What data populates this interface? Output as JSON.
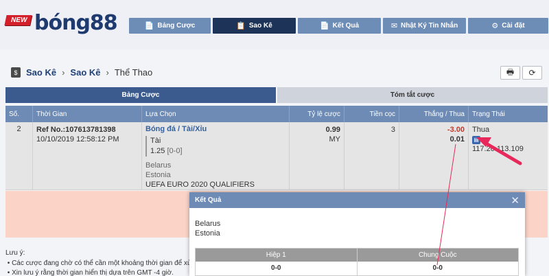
{
  "logo": {
    "badge": "NEW",
    "brand": "bóng88"
  },
  "nav": [
    {
      "icon": "📄",
      "label": "Bảng Cược"
    },
    {
      "icon": "📋",
      "label": "Sao Kê"
    },
    {
      "icon": "📄",
      "label": "Kết Quả"
    },
    {
      "icon": "✉",
      "label": "Nhật Ký Tin Nhắn"
    },
    {
      "icon": "⚙",
      "label": "Cài đặt"
    }
  ],
  "breadcrumb": {
    "icon": "$",
    "items": [
      "Sao Kê",
      "Sao Kê"
    ],
    "current": "Thể Thao",
    "sep": "›"
  },
  "tools": {
    "print": "🖶",
    "refresh": "⟳"
  },
  "tabs": [
    "Bảng Cược",
    "Tóm tắt cược"
  ],
  "table": {
    "headers": [
      "Số.",
      "Thời Gian",
      "Lựa Chọn",
      "Tỷ lệ cược",
      "Tiền cọc",
      "Thắng / Thua",
      "Trạng Thái"
    ],
    "row": {
      "no": "2",
      "ref": "Ref No.:107613781398",
      "time": "10/10/2019 12:58:12 PM",
      "sport": "Bóng đá / Tài/Xỉu",
      "pick": "Tài",
      "line": "1.25",
      "score": "[0-0]",
      "team1": "Belarus",
      "team2": "Estonia",
      "league": "UEFA EURO 2020 QUALIFIERS",
      "odds": "0.99",
      "odds_type": "MY",
      "stake": "3",
      "win_loss": "-3.00",
      "commission": "0.01",
      "status": "Thua",
      "ip": "117.20.113.109"
    }
  },
  "notes": {
    "title": "Lưu ý:",
    "items": [
      "Các cược đang chờ có thể cần một khoảng thời gian để xử",
      "Xin lưu ý rằng thời gian hiển thị dựa trên GMT -4 giờ."
    ]
  },
  "modal": {
    "title": "Kết Quả",
    "close": "✕",
    "team1": "Belarus",
    "team2": "Estonia",
    "headers": [
      "Hiệp 1",
      "Chung Cuộc"
    ],
    "values": [
      "0-0",
      "0-0"
    ]
  },
  "colors": {
    "nav": "#6d8cb6",
    "nav_active": "#1d3357",
    "arrow": "#e8285a",
    "loss": "#c0392b"
  }
}
